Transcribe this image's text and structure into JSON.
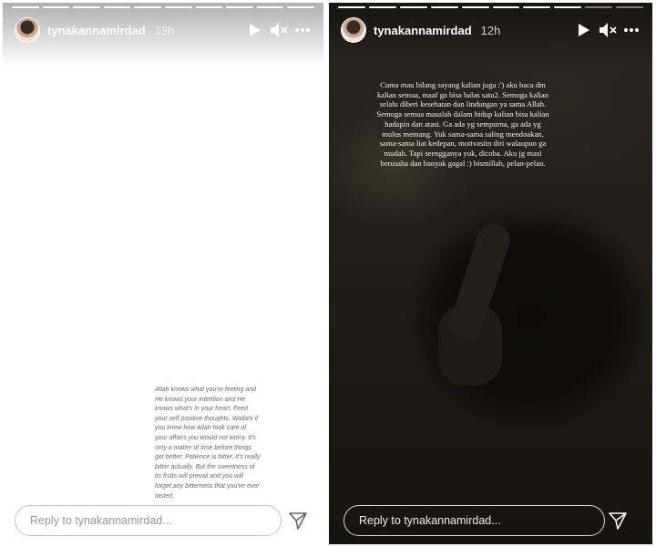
{
  "stories": [
    {
      "username": "tynakannamirdad",
      "time": "13h",
      "progress": {
        "segments": 10,
        "completed": 10
      },
      "caption_lines": [
        "Allah knows what you're feeling and",
        "He knows your intention and He",
        "knows what's in your heart. Feed",
        "your self positive thoughts. Wallahi if",
        "you knew how Allah took care of",
        "your affairs you would not worry. It's",
        "only a matter of time before things",
        "get better. Patience is bitter, it's really",
        "bitter actually. But the sweetness of",
        "its fruits will prevail and you will",
        "forget any bitterness that you've ever",
        "tasted."
      ],
      "reply_placeholder": "Reply to tynakannamirdad...",
      "icons": {
        "play": "play-icon",
        "mute": "mute-icon",
        "more": "more-icon",
        "send": "send-icon"
      },
      "theme": "light"
    },
    {
      "username": "tynakannamirdad",
      "time": "12h",
      "progress": {
        "segments": 10,
        "completed": 8
      },
      "caption_lines": [
        "Cuma mau bilang sayang kalian juga :') aku baca dm",
        "kalian semua, maaf ga bisa balas satu2. Semoga kalian",
        "selalu diberi kesehatan dan lindungan ya sama Allah.",
        "Semoga semua masalah dalam hidup kalian bisa kalian",
        "hadapin dan atasi. Ga ada yg sempurna, ga ada yg",
        "mulus memang. Yuk sama-sama saling mendoakan,",
        "sama-sama liat kedepan, motivasiin diri walaupun ga",
        "mudah. Tapi seengganya yuk, dicoba. Aku jg masi",
        "berusaha dan banyak gagal :) bismillah, pelan-pelan."
      ],
      "reply_placeholder": "Reply to tynakannamirdad...",
      "icons": {
        "play": "play-icon",
        "mute": "mute-icon",
        "more": "more-icon",
        "send": "send-icon"
      },
      "theme": "dark"
    }
  ]
}
